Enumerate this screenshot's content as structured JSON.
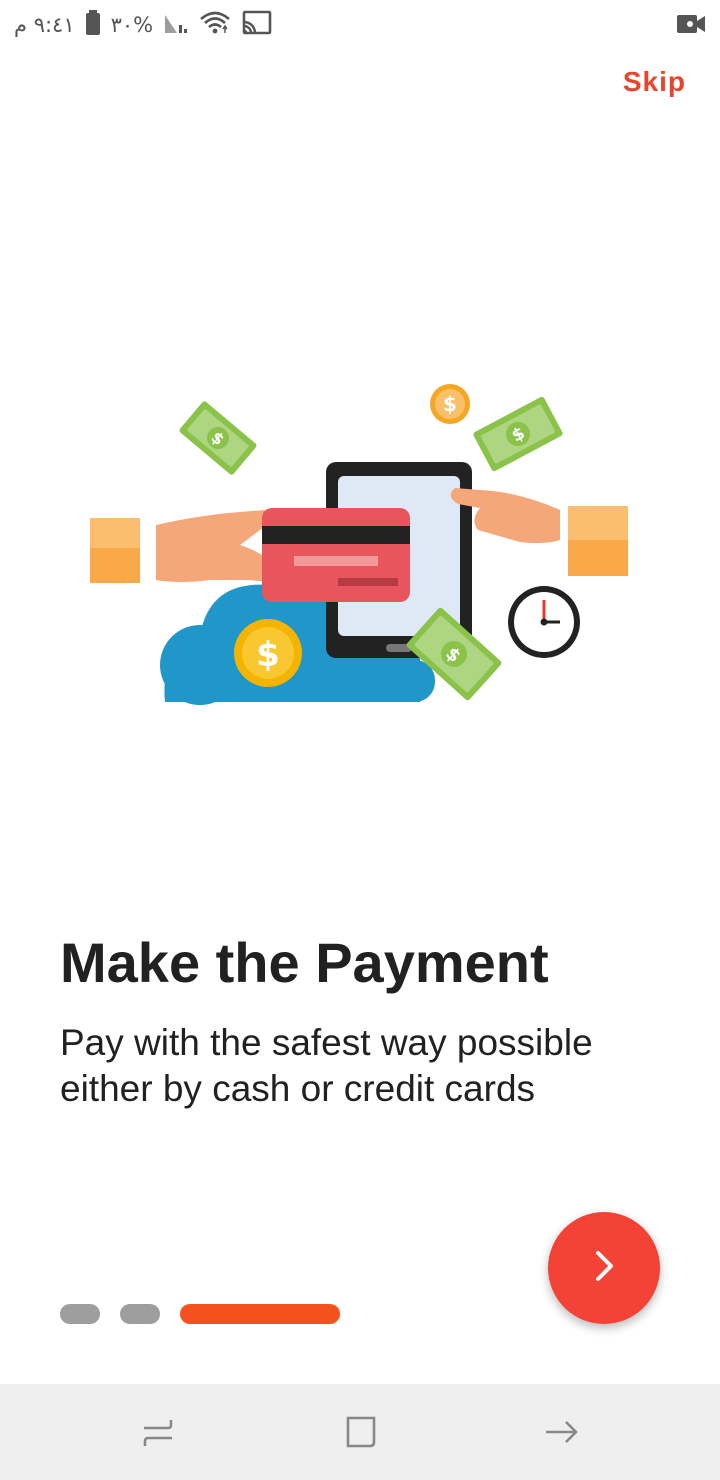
{
  "status_bar": {
    "time": "٩:٤١ م",
    "battery_percent": "%٣٠",
    "icons": [
      "battery-icon",
      "signal-icon",
      "wifi-icon",
      "cast-icon",
      "video-camera-icon"
    ]
  },
  "onboarding": {
    "skip_label": "Skip",
    "title": "Make the Payment",
    "subtitle": "Pay with the safest way possible either by cash or credit cards",
    "page_count": 3,
    "current_page": 3,
    "next_button_icon": "chevron-right-icon",
    "illustration": "payment-illustration"
  },
  "colors": {
    "accent": "#e8452e",
    "fab": "#f44336",
    "indicator_active": "#f4511e",
    "indicator_inactive": "#9e9e9e"
  },
  "nav_bar": {
    "buttons": [
      "recent-apps-icon",
      "home-icon",
      "back-icon"
    ]
  }
}
